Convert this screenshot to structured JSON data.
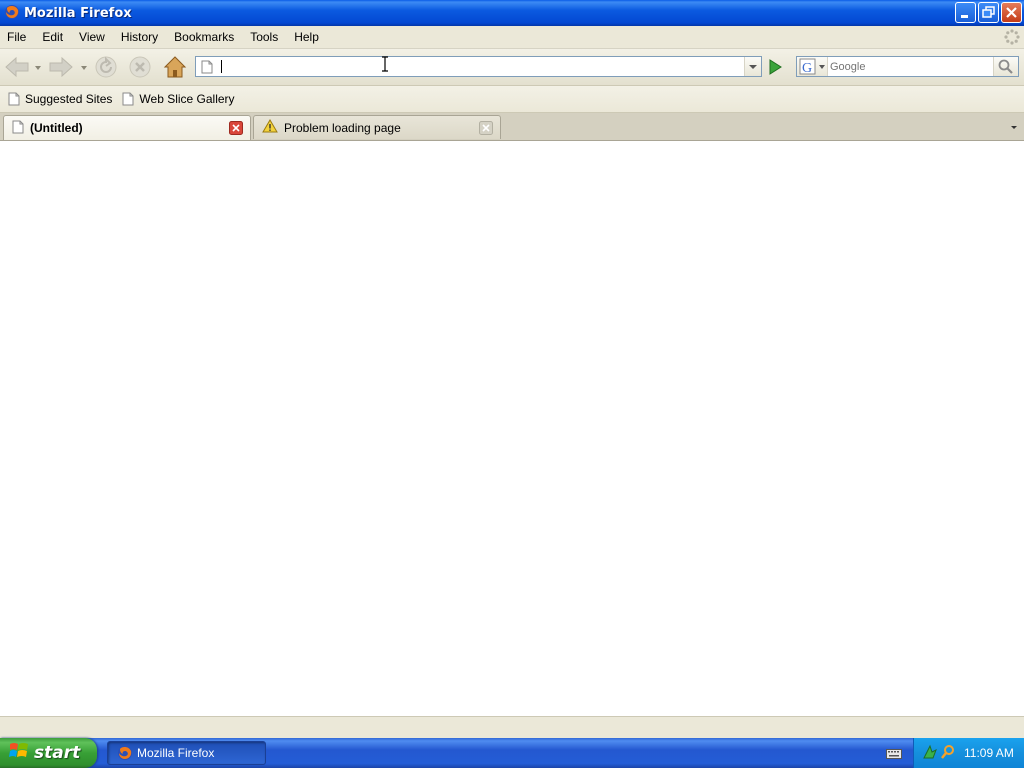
{
  "window": {
    "title": "Mozilla Firefox"
  },
  "menu": [
    "File",
    "Edit",
    "View",
    "History",
    "Bookmarks",
    "Tools",
    "Help"
  ],
  "navigation": {
    "url_value": "",
    "search_placeholder": "Google",
    "search_engine_letter": "G"
  },
  "bookmarks": [
    "Suggested Sites",
    "Web Slice Gallery"
  ],
  "tabs": [
    {
      "label": "(Untitled)",
      "active": true,
      "icon": "page-icon"
    },
    {
      "label": "Problem loading page",
      "active": false,
      "icon": "warning-icon"
    }
  ],
  "status": {
    "text": ""
  },
  "taskbar": {
    "start_label": "start",
    "task_label": "Mozilla Firefox",
    "clock": "11:09 AM"
  },
  "colors": {
    "titlebar": "#0b5ae0",
    "taskbar": "#245dd6",
    "start": "#38a036",
    "tray": "#1590dd"
  }
}
